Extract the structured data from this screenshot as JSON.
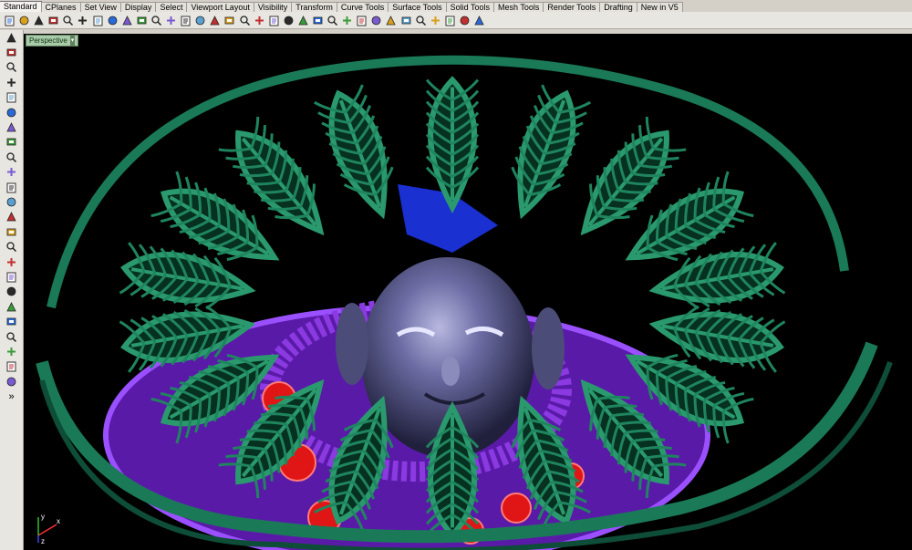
{
  "tabs": [
    "Standard",
    "CPlanes",
    "Set View",
    "Display",
    "Select",
    "Viewport Layout",
    "Visibility",
    "Transform",
    "Curve Tools",
    "Surface Tools",
    "Solid Tools",
    "Mesh Tools",
    "Render Tools",
    "Drafting",
    "New in V5"
  ],
  "active_tab": "Standard",
  "viewport": {
    "label": "Perspective",
    "dropdown_glyph": "▾"
  },
  "axes": {
    "x": "x",
    "y": "y",
    "z": "z"
  },
  "toolbar_icons": [
    "new-file-icon",
    "open-file-icon",
    "save-icon",
    "print-icon",
    "import-icon",
    "cut-icon",
    "copy-icon",
    "paste-icon",
    "undo-icon",
    "pan-icon",
    "rotate-view-icon",
    "zoom-icon",
    "zoom-window-icon",
    "zoom-extents-icon",
    "zoom-selected-icon",
    "undo-view-icon",
    "four-views-icon",
    "grid-snap-icon",
    "select-icon",
    "hide-icon",
    "show-icon",
    "light-icon",
    "lock-icon",
    "layer-icon",
    "material-icon",
    "properties-icon",
    "render-preview-icon",
    "shaded-icon",
    "rendered-icon",
    "render-icon",
    "sweep-icon",
    "drafting-icon",
    "help-icon"
  ],
  "left_tools": [
    "select-arrow-icon",
    "point-icon",
    "polyline-icon",
    "curve-icon",
    "circle-icon",
    "arc-icon",
    "ellipse-icon",
    "rectangle-icon",
    "polygon-icon",
    "fillet-icon",
    "surface-icon",
    "extrude-icon",
    "solid-box-icon",
    "sphere-icon",
    "cylinder-icon",
    "mesh-icon",
    "loft-icon",
    "boolean-icon",
    "transform-icon",
    "array-icon",
    "text-icon",
    "dimension-icon",
    "layout-icon",
    "render-cube-icon",
    "more-icon"
  ],
  "more_glyph": "»",
  "colors": {
    "viewport_bg": "#000000",
    "leaf_green": "#1e7a58",
    "base_purple": "#7a2ad0",
    "gem_red": "#e01515",
    "face_blue": "#56568a"
  }
}
